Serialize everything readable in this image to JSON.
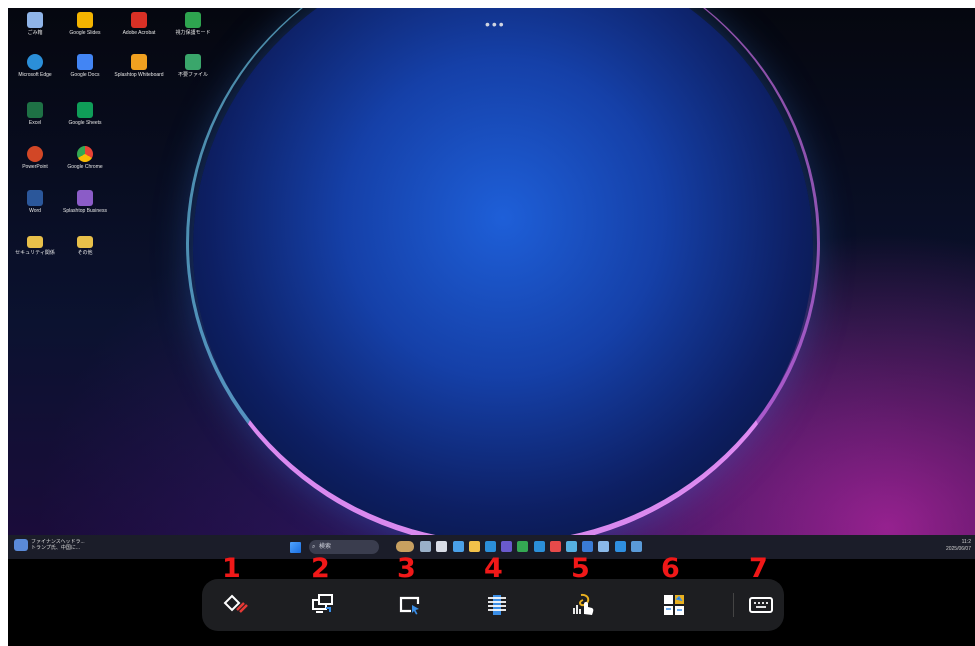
{
  "desktop_icons": [
    {
      "label": "ごみ箱",
      "color": "#8fb4e8"
    },
    {
      "label": "Google Slides",
      "color": "#f4b400"
    },
    {
      "label": "Adobe Acrobat",
      "color": "#d93025"
    },
    {
      "label": "視力保護モード",
      "color": "#2ea44f"
    },
    {
      "label": "Microsoft Edge",
      "color": "#2b8fd9"
    },
    {
      "label": "Google Docs",
      "color": "#4285f4"
    },
    {
      "label": "Splashtop Whiteboard",
      "color": "#f0a020"
    },
    {
      "label": "不要ファイル",
      "color": "#3aa66b"
    },
    {
      "label": "Excel",
      "color": "#1e7145"
    },
    {
      "label": "Google Sheets",
      "color": "#0f9d58"
    },
    {
      "label": "PowerPoint",
      "color": "#d24726"
    },
    {
      "label": "Google Chrome",
      "color": "#e8a317"
    },
    {
      "label": "Word",
      "color": "#2b579a"
    },
    {
      "label": "Splashtop Business",
      "color": "#8b5cc7"
    },
    {
      "label": "セキュリティ関係",
      "color": "#e8c04a"
    },
    {
      "label": "その他",
      "color": "#e8c04a"
    }
  ],
  "more_dots": "•••",
  "taskbar": {
    "weather_title": "ファイナンスヘッドラ...",
    "weather_sub": "トランプ氏、中国に...",
    "search_label": "検索",
    "clock_time": "11:2",
    "clock_date": "2025/06/07"
  },
  "taskbar_icon_colors": [
    "#c8a060",
    "#9ab0c8",
    "#d8dce6",
    "#4aa0e8",
    "#f2c14a",
    "#2b8fd9",
    "#6a5acd",
    "#34a853",
    "#2b8fd9",
    "#e84a4a",
    "#55b0e0",
    "#3a7bd5",
    "#8ab8e8",
    "#2f8fe0",
    "#5a9ad8"
  ],
  "annotations": [
    "1",
    "2",
    "3",
    "4",
    "5",
    "6",
    "7"
  ],
  "toolbar_icons": [
    "pen-annotate-icon",
    "screen-mirror-icon",
    "window-cursor-icon",
    "list-settings-icon",
    "touch-gesture-icon",
    "multi-view-icon",
    "keyboard-icon"
  ],
  "colors": {
    "annotation": "#f01818",
    "toolbar_bg": "#1d1e21",
    "taskbar_bg": "#1b1d29"
  }
}
